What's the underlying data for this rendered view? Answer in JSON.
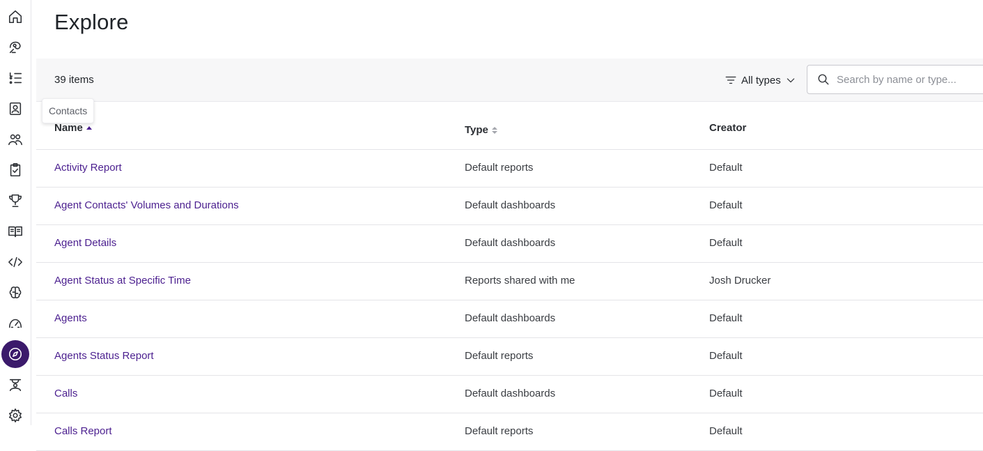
{
  "page": {
    "title": "Explore"
  },
  "toolbar": {
    "count": "39 items",
    "filter_label": "All types",
    "search_placeholder": "Search by name or type..."
  },
  "tooltip": "Contacts",
  "table": {
    "headers": {
      "name": "Name",
      "type": "Type",
      "creator": "Creator"
    },
    "rows": [
      {
        "name": "Activity Report",
        "type": "Default reports",
        "creator": "Default"
      },
      {
        "name": "Agent Contacts' Volumes and Durations",
        "type": "Default dashboards",
        "creator": "Default"
      },
      {
        "name": "Agent Details",
        "type": "Default dashboards",
        "creator": "Default"
      },
      {
        "name": "Agent Status at Specific Time",
        "type": "Reports shared with me",
        "creator": "Josh Drucker"
      },
      {
        "name": "Agents",
        "type": "Default dashboards",
        "creator": "Default"
      },
      {
        "name": "Agents Status Report",
        "type": "Default reports",
        "creator": "Default"
      },
      {
        "name": "Calls",
        "type": "Default dashboards",
        "creator": "Default"
      },
      {
        "name": "Calls Report",
        "type": "Default reports",
        "creator": "Default"
      }
    ]
  },
  "colors": {
    "accent": "#4b1f8f",
    "active_nav": "#3b1a6b"
  },
  "sidebar_icons": [
    "home-icon",
    "agent-assist-icon",
    "list-icon",
    "contacts-icon",
    "users-icon",
    "tasks-icon",
    "trophy-icon",
    "book-icon",
    "code-icon",
    "brain-icon",
    "speedometer-icon",
    "explore-icon",
    "workforce-icon",
    "settings-icon"
  ]
}
